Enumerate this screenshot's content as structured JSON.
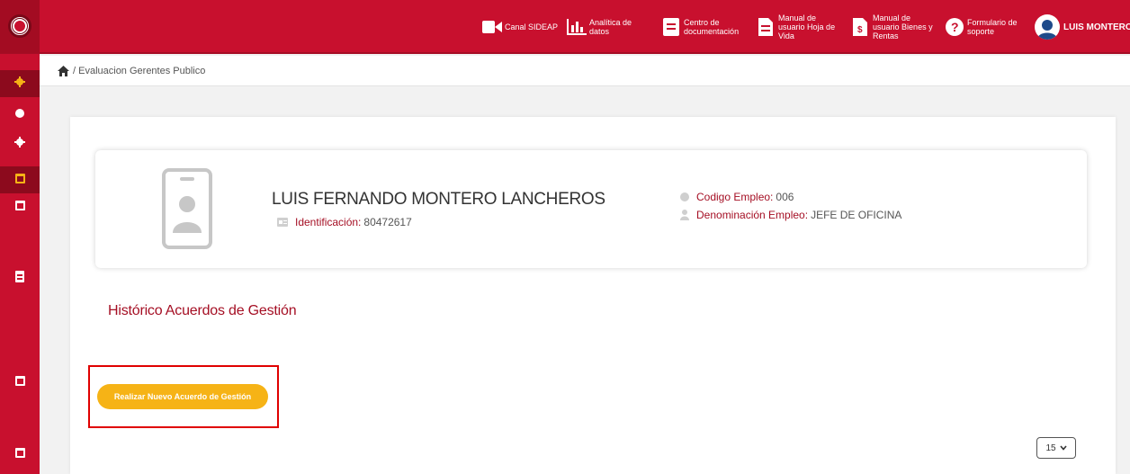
{
  "header": {
    "nav": [
      {
        "label": "Canal SIDEAP",
        "icon": "video-camera-icon"
      },
      {
        "label": "Analítica de datos",
        "icon": "bar-chart-icon"
      },
      {
        "label": "Centro de documentación",
        "icon": "document-list-icon"
      },
      {
        "label": "Manual de usuario Hoja de Vida",
        "icon": "manual-document-icon"
      },
      {
        "label": "Manual de usuario Bienes y Rentas",
        "icon": "money-document-icon"
      },
      {
        "label": "Formulario de soporte",
        "icon": "question-circle-icon"
      }
    ],
    "user_name": "LUIS MONTERO"
  },
  "breadcrumb": {
    "current": "/ Evaluacion Gerentes Publico"
  },
  "profile": {
    "name": "LUIS FERNANDO MONTERO LANCHEROS",
    "identification_label": "Identificación:",
    "identification_value": "80472617",
    "employee_code_label": "Codigo Empleo:",
    "employee_code_value": "006",
    "position_label": "Denominación Empleo:",
    "position_value": "JEFE DE OFICINA"
  },
  "section": {
    "title": "Histórico Acuerdos de Gestión",
    "new_button": "Realizar Nuevo Acuerdo de Gestión"
  },
  "pagination": {
    "page_size": "15"
  },
  "colors": {
    "brand_red": "#c8102e",
    "accent_yellow": "#f6b316",
    "highlight_red": "#e00000"
  }
}
